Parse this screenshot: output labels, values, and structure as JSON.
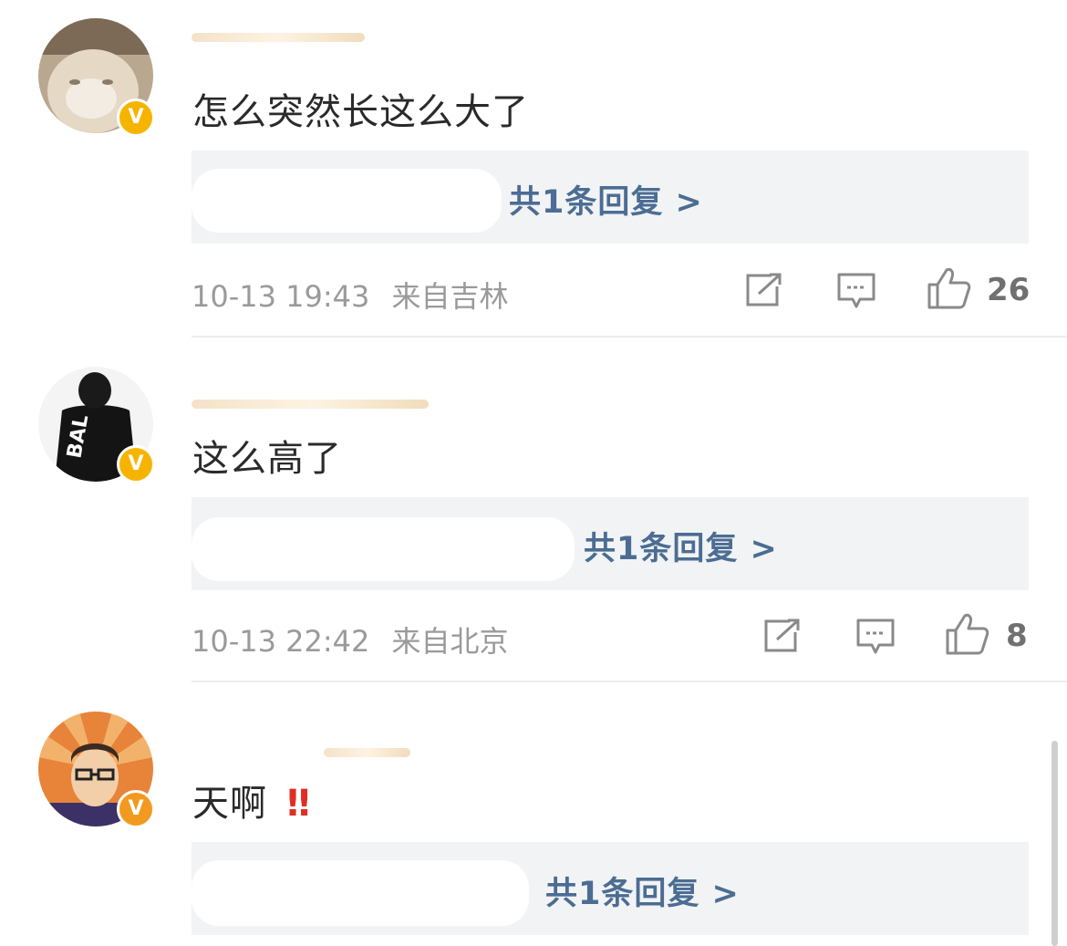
{
  "colors": {
    "link": "#4b6d93",
    "reply_bg": "#f2f3f5",
    "meta_text": "#9a9a9a",
    "badge_yellow": "#f6b400",
    "badge_orange": "#f29a1f",
    "exclaim": "#e02e24"
  },
  "comments": [
    {
      "text": "怎么突然长这么大了",
      "reply_link": "共1条回复 >",
      "date": "10-13 19:43",
      "location": "来自吉林",
      "likes": "26",
      "badge": "V",
      "icons": [
        "repost-icon",
        "comment-icon",
        "like-icon"
      ]
    },
    {
      "text": "这么高了",
      "reply_link": "共1条回复 >",
      "date": "10-13 22:42",
      "location": "来自北京",
      "likes": "8",
      "badge": "V",
      "icons": [
        "repost-icon",
        "comment-icon",
        "like-icon"
      ]
    },
    {
      "text": "天啊",
      "emoji": "‼",
      "reply_link": "共1条回复 >",
      "badge": "V"
    }
  ]
}
